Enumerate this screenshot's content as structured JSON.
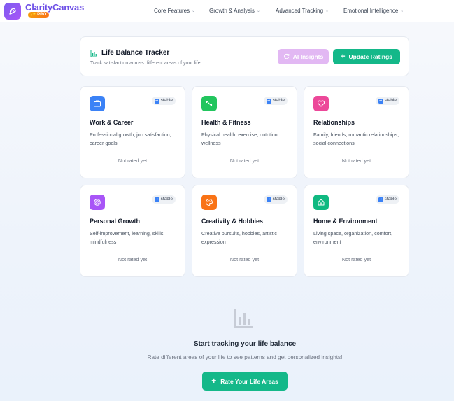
{
  "brand": {
    "name": "ClarityCanvas",
    "badge": "✨ PRO"
  },
  "nav": [
    {
      "label": "Core Features"
    },
    {
      "label": "Growth & Analysis"
    },
    {
      "label": "Advanced Tracking"
    },
    {
      "label": "Emotional Intelligence"
    }
  ],
  "tracker": {
    "title": "Life Balance Tracker",
    "subtitle": "Track satisfaction across different areas of your life",
    "ai_label": "AI Insights",
    "update_label": "Update Ratings"
  },
  "areas": [
    {
      "title": "Work & Career",
      "description": "Professional growth, job satisfaction, career goals",
      "status": "Not rated yet",
      "trend": "stable",
      "icon": "briefcase-icon",
      "color": "#3b82f6"
    },
    {
      "title": "Health & Fitness",
      "description": "Physical health, exercise, nutrition, wellness",
      "status": "Not rated yet",
      "trend": "stable",
      "icon": "expand-icon",
      "color": "#22c55e"
    },
    {
      "title": "Relationships",
      "description": "Family, friends, romantic relationships, social connections",
      "status": "Not rated yet",
      "trend": "stable",
      "icon": "heart-icon",
      "color": "#ec4899"
    },
    {
      "title": "Personal Growth",
      "description": "Self-improvement, learning, skills, mindfulness",
      "status": "Not rated yet",
      "trend": "stable",
      "icon": "target-icon",
      "color": "#a855f7"
    },
    {
      "title": "Creativity & Hobbies",
      "description": "Creative pursuits, hobbies, artistic expression",
      "status": "Not rated yet",
      "trend": "stable",
      "icon": "palette-icon",
      "color": "#f97316"
    },
    {
      "title": "Home & Environment",
      "description": "Living space, organization, comfort, environment",
      "status": "Not rated yet",
      "trend": "stable",
      "icon": "home-icon",
      "color": "#10b981"
    }
  ],
  "empty_state": {
    "title": "Start tracking your life balance",
    "subtitle": "Rate different areas of your life to see patterns and get personalized insights!",
    "button_label": "Rate Your Life Areas"
  },
  "colors": {
    "brand": "#6d4fe6",
    "accent_green": "#14b889",
    "ai_button": "#e2b8f3"
  }
}
